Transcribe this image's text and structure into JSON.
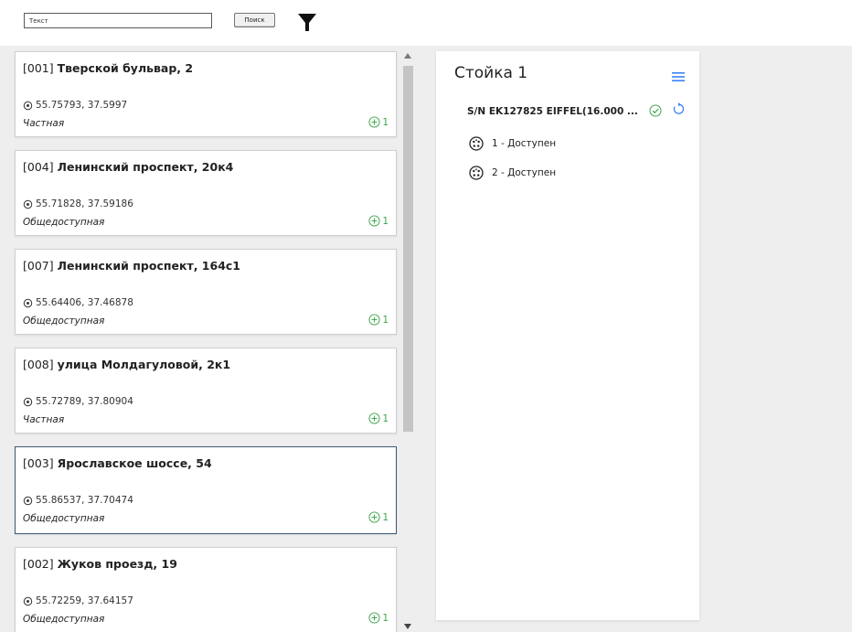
{
  "search": {
    "value": "Текст",
    "button_label": "Поиск"
  },
  "stations": [
    {
      "id": "[001]",
      "name": "Тверской бульвар, 2",
      "coords": "55.75793, 37.5997",
      "type": "Частная",
      "count": "1",
      "selected": false
    },
    {
      "id": "[004]",
      "name": "Ленинский проспект, 20к4",
      "coords": "55.71828, 37.59186",
      "type": "Общедоступная",
      "count": "1",
      "selected": false
    },
    {
      "id": "[007]",
      "name": "Ленинский проспект, 164с1",
      "coords": "55.64406, 37.46878",
      "type": "Общедоступная",
      "count": "1",
      "selected": false
    },
    {
      "id": "[008]",
      "name": "улица Молдагуловой, 2к1",
      "coords": "55.72789, 37.80904",
      "type": "Частная",
      "count": "1",
      "selected": false
    },
    {
      "id": "[003]",
      "name": "Ярославское шоссе, 54",
      "coords": "55.86537, 37.70474",
      "type": "Общедоступная",
      "count": "1",
      "selected": true
    },
    {
      "id": "[002]",
      "name": "Жуков проезд, 19",
      "coords": "55.72259, 37.64157",
      "type": "Общедоступная",
      "count": "1",
      "selected": false
    }
  ],
  "detail": {
    "title": "Стойка 1",
    "charger": "S/N EK127825 EIFFEL(16.000 ...",
    "connectors": [
      {
        "label": "1 - Доступен"
      },
      {
        "label": "2 - Доступен"
      }
    ]
  },
  "colors": {
    "accent": "#3b82f6",
    "status_green": "#3fa34d",
    "selected_border": "#3f5877",
    "panel_background": "#eeeeee"
  },
  "icons": [
    "filter-icon",
    "location-pin-icon",
    "plus-circle-icon",
    "menu-icon",
    "check-circle-icon",
    "refresh-icon",
    "connector-socket-icon"
  ]
}
